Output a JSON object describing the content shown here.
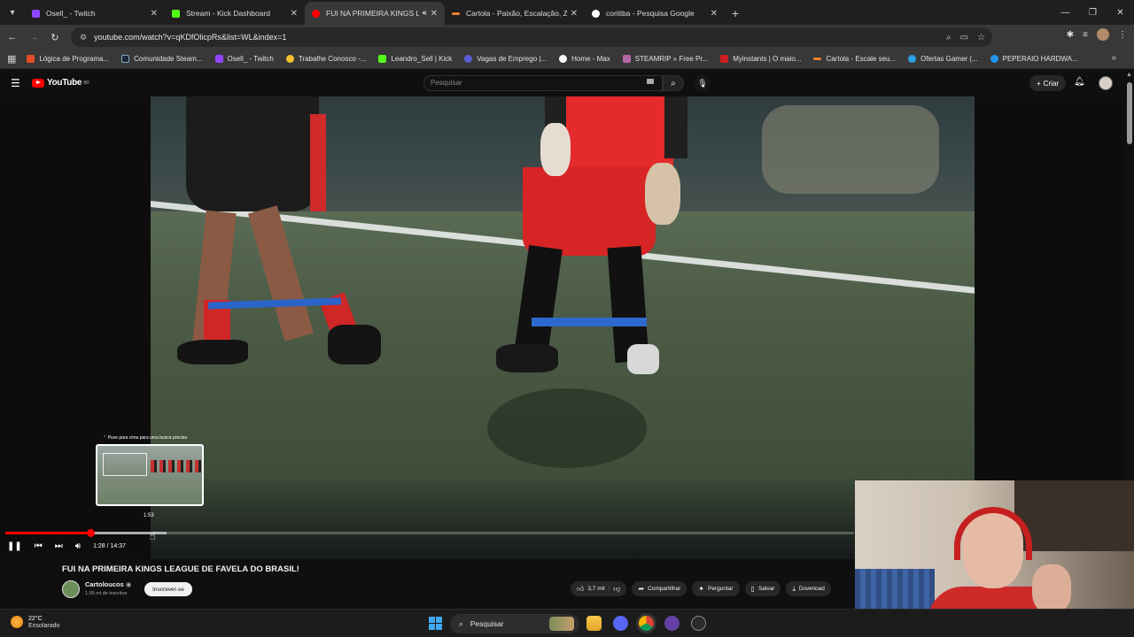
{
  "browser": {
    "tabs": [
      {
        "label": "Osell_ - Twitch",
        "color": "#9146ff",
        "active": false
      },
      {
        "label": "Stream - Kick Dashboard",
        "color": "#53fc18",
        "active": false
      },
      {
        "label": "FUI NA PRIMEIRA KINGS LE",
        "color": "#ff0000",
        "active": true
      },
      {
        "label": "Cartola - Paixão, Escalação, Zo",
        "color": "#f0802e",
        "active": false
      },
      {
        "label": "coritiba - Pesquisa Google",
        "color": "#ffffff",
        "active": false
      }
    ],
    "url": "youtube.com/watch?v=qKDfOlicpRs&list=WL&index=1",
    "bookmarks": [
      {
        "label": "Lógica de Programa...",
        "color": "#e44d26"
      },
      {
        "label": "Comunidade Steam...",
        "color": "#1b2838"
      },
      {
        "label": "Osell_ - Twitch",
        "color": "#9146ff"
      },
      {
        "label": "Trabalhe Conosco -...",
        "color": "#f4c430"
      },
      {
        "label": "Leandro_Sell | Kick",
        "color": "#53fc18"
      },
      {
        "label": "Vagas de Emprego |...",
        "color": "#5b5bd6"
      },
      {
        "label": "Home - Max",
        "color": "#ffffff"
      },
      {
        "label": "STEAMRIP » Free Pr...",
        "color": "#b565a7"
      },
      {
        "label": "Myinstants | O maio...",
        "color": "#cc1f1f"
      },
      {
        "label": "Cartola - Escale seu...",
        "color": "#f0802e"
      },
      {
        "label": "Ofertas Gamer (...",
        "color": "#2aa1e0"
      },
      {
        "label": "PEPERAIO HARDWA...",
        "color": "#2196f3"
      }
    ]
  },
  "youtube": {
    "logo_text": "YouTube",
    "logo_region": "BR",
    "search_placeholder": "Pesquisar",
    "create_label": "Criar"
  },
  "player": {
    "preview_hint": "Puxe para cima para uma busca precisa",
    "preview_time": "1:53",
    "time_display": "1:28 / 14:37",
    "played_fraction": 0.1,
    "buffered_fraction": 0.19
  },
  "video": {
    "title": "FUI NA PRIMEIRA KINGS LEAGUE DE FAVELA DO BRASIL!",
    "channel": "Cartoloucos",
    "subscribers": "1,55 mi de inscritos",
    "subscribe_label": "Inscrever-se",
    "likes": "3,7 mil",
    "share_label": "Compartilhar",
    "ask_label": "Perguntar",
    "save_label": "Salvar",
    "download_label": "Download"
  },
  "taskbar": {
    "temperature": "22°C",
    "condition": "Ensolarado",
    "search_label": "Pesquisar"
  }
}
